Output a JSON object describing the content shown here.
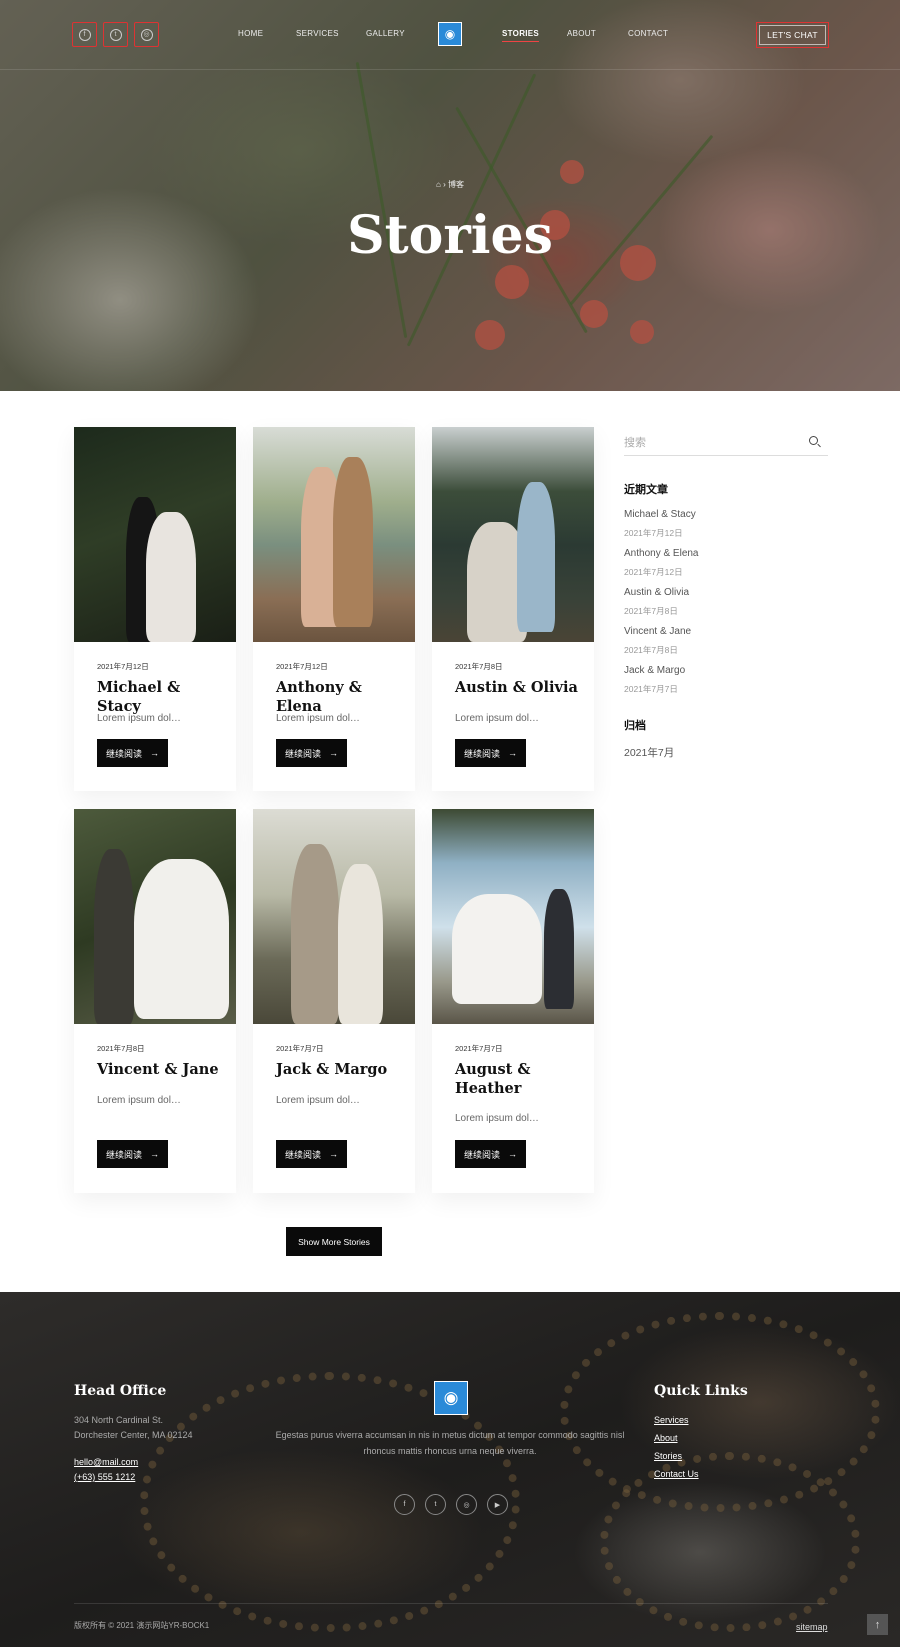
{
  "nav": {
    "social": [
      {
        "icon": "facebook-icon",
        "glyph": "f"
      },
      {
        "icon": "twitter-icon",
        "glyph": "t"
      },
      {
        "icon": "instagram-icon",
        "glyph": "◎"
      }
    ],
    "links": [
      "HOME",
      "SERVICES",
      "GALLERY",
      "STORIES",
      "ABOUT",
      "CONTACT"
    ],
    "active": "STORIES",
    "cta": "LET'S CHAT"
  },
  "hero": {
    "breadcrumb_sep": "›",
    "breadcrumb_current": "博客",
    "title": "Stories"
  },
  "cards": [
    {
      "date": "2021年7月12日",
      "title": "Michael & Stacy",
      "excerpt": "Lorem ipsum dol…",
      "button": "继续阅读"
    },
    {
      "date": "2021年7月12日",
      "title": "Anthony & Elena",
      "excerpt": "Lorem ipsum dol…",
      "button": "继续阅读"
    },
    {
      "date": "2021年7月8日",
      "title": "Austin & Olivia",
      "excerpt": "Lorem ipsum dol…",
      "button": "继续阅读"
    },
    {
      "date": "2021年7月8日",
      "title": "Vincent & Jane",
      "excerpt": "Lorem ipsum dol…",
      "button": "继续阅读"
    },
    {
      "date": "2021年7月7日",
      "title": "Jack & Margo",
      "excerpt": "Lorem ipsum dol…",
      "button": "继续阅读"
    },
    {
      "date": "2021年7月7日",
      "title": "August & Heather",
      "excerpt": "Lorem ipsum dol…",
      "button": "继续阅读"
    }
  ],
  "sidebar": {
    "search_placeholder": "搜索",
    "recent_heading": "近期文章",
    "recent": [
      {
        "title": "Michael & Stacy",
        "date": "2021年7月12日"
      },
      {
        "title": "Anthony & Elena",
        "date": "2021年7月12日"
      },
      {
        "title": "Austin & Olivia",
        "date": "2021年7月8日"
      },
      {
        "title": "Vincent & Jane",
        "date": "2021年7月8日"
      },
      {
        "title": "Jack & Margo",
        "date": "2021年7月7日"
      }
    ],
    "archive_heading": "归档",
    "archive": [
      "2021年7月"
    ]
  },
  "show_more": "Show More Stories",
  "footer": {
    "office_heading": "Head Office",
    "address1": "304 North Cardinal St.",
    "address2": "Dorchester Center, MA 02124",
    "email": "hello@mail.com",
    "phone": "(+63) 555 1212",
    "about1": "Egestas purus viverra accumsan in nis in metus dictum at tempor commodo sagittis nisl",
    "about2": "rhoncus mattis rhoncus urna neque viverra.",
    "social": [
      {
        "icon": "facebook-icon",
        "glyph": "f"
      },
      {
        "icon": "twitter-icon",
        "glyph": "t"
      },
      {
        "icon": "instagram-icon",
        "glyph": "◎"
      },
      {
        "icon": "youtube-icon",
        "glyph": "▶"
      }
    ],
    "links_heading": "Quick Links",
    "links": [
      "Services",
      "About",
      "Stories",
      "Contact Us"
    ],
    "copyright": "版权所有 © 2021 演示网站YR-BOCK1",
    "sitemap": "sitemap",
    "top_glyph": "↑"
  },
  "colors": {
    "accent": "#dd3333",
    "button": "#0a0a0a",
    "logo": "#2a8ad8"
  }
}
